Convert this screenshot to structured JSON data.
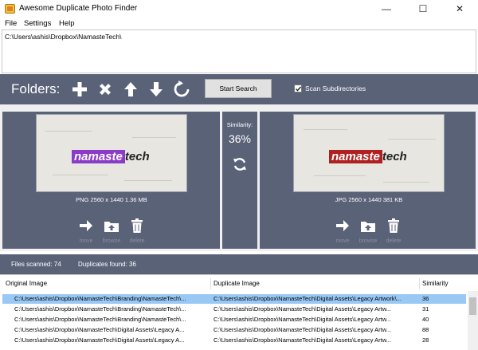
{
  "window": {
    "title": "Awesome Duplicate Photo Finder",
    "minimize": "—",
    "maximize": "☐",
    "close": "✕"
  },
  "menu": [
    "File",
    "Settings",
    "Help"
  ],
  "folders_list": [
    "C:\\Users\\ashis\\Dropbox\\NamasteTech\\"
  ],
  "toolbar": {
    "folders_label": "Folders:",
    "icons": [
      "plus-icon",
      "remove-icon",
      "up-arrow-icon",
      "down-arrow-icon",
      "reset-icon"
    ],
    "start_search": "Start Search",
    "scan_subdirectories": "Scan Subdirectories",
    "scan_checked": true
  },
  "left_image": {
    "logo_part1": "namaste",
    "logo_part2": "tech",
    "info": "PNG  2560 x 1440  1.36 MB",
    "actions": [
      "move",
      "browse",
      "delete"
    ]
  },
  "right_image": {
    "logo_part1": "namaste",
    "logo_part2": "tech",
    "info": "JPG  2560 x 1440  381 KB",
    "actions": [
      "move",
      "browse",
      "delete"
    ]
  },
  "similarity": {
    "label": "Similarity:",
    "value": "36%"
  },
  "status": {
    "files_scanned": "Files scanned: 74",
    "duplicates_found": "Duplicates found: 36"
  },
  "table": {
    "headers": [
      "Original Image",
      "Duplicate Image",
      "Similarity"
    ],
    "rows": [
      [
        "C:\\Users\\ashis\\Dropbox\\NamasteTech\\Branding\\NamasteTech\\...",
        "C:\\Users\\ashis\\Dropbox\\NamasteTech\\Digital Assets\\Legacy Artwork\\...",
        "36"
      ],
      [
        "C:\\Users\\ashis\\Dropbox\\NamasteTech\\Branding\\NamasteTech\\...",
        "C:\\Users\\ashis\\Dropbox\\NamasteTech\\Digital Assets\\Legacy Artw...",
        "31"
      ],
      [
        "C:\\Users\\ashis\\Dropbox\\NamasteTech\\Branding\\NamasteTech\\...",
        "C:\\Users\\ashis\\Dropbox\\NamasteTech\\Digital Assets\\Legacy Artw...",
        "40"
      ],
      [
        "C:\\Users\\ashis\\Dropbox\\NamasteTech\\Digital Assets\\Legacy A...",
        "C:\\Users\\ashis\\Dropbox\\NamasteTech\\Digital Assets\\Legacy Artw...",
        "88"
      ],
      [
        "C:\\Users\\ashis\\Dropbox\\NamasteTech\\Digital Assets\\Legacy A...",
        "C:\\Users\\ashis\\Dropbox\\NamasteTech\\Digital Assets\\Legacy Artw...",
        "28"
      ]
    ],
    "selected_row": 0
  },
  "colors": {
    "panel_bg": "#5a6278",
    "selection": "#99c8f5",
    "logo_left_accent": "#8a3cc8",
    "logo_right_accent": "#b02020"
  }
}
